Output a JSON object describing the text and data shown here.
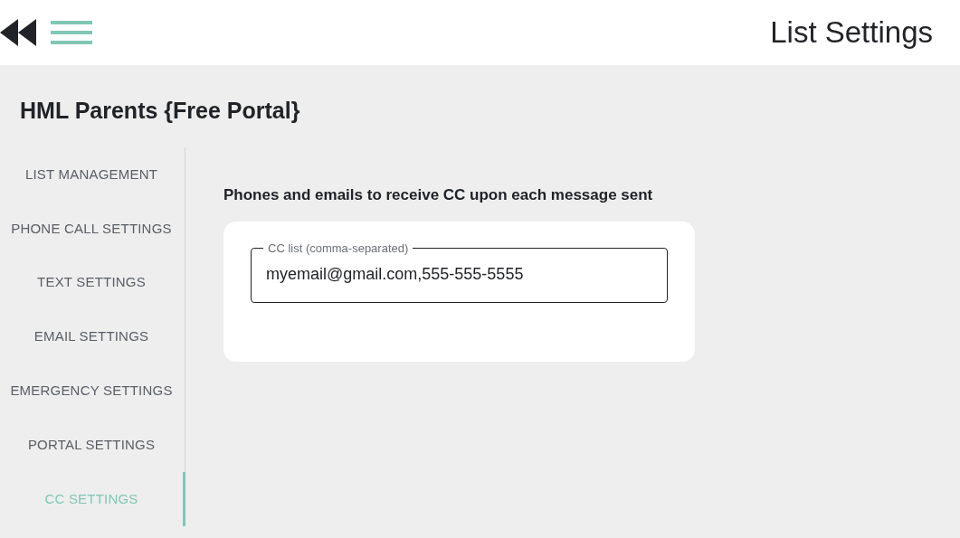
{
  "header": {
    "title": "List Settings"
  },
  "list_name": "HML Parents {Free Portal}",
  "sidebar": {
    "items": [
      {
        "label": "LIST MANAGEMENT",
        "selected": false
      },
      {
        "label": "PHONE CALL SETTINGS",
        "selected": false
      },
      {
        "label": "TEXT SETTINGS",
        "selected": false
      },
      {
        "label": "EMAIL SETTINGS",
        "selected": false
      },
      {
        "label": "EMERGENCY SETTINGS",
        "selected": false
      },
      {
        "label": "PORTAL SETTINGS",
        "selected": false
      },
      {
        "label": "CC SETTINGS",
        "selected": true
      }
    ]
  },
  "section": {
    "heading": "Phones and emails to receive CC upon each message sent",
    "field": {
      "label": "CC list (comma-separated)",
      "value": "myemail@gmail.com,555-555-5555"
    }
  }
}
